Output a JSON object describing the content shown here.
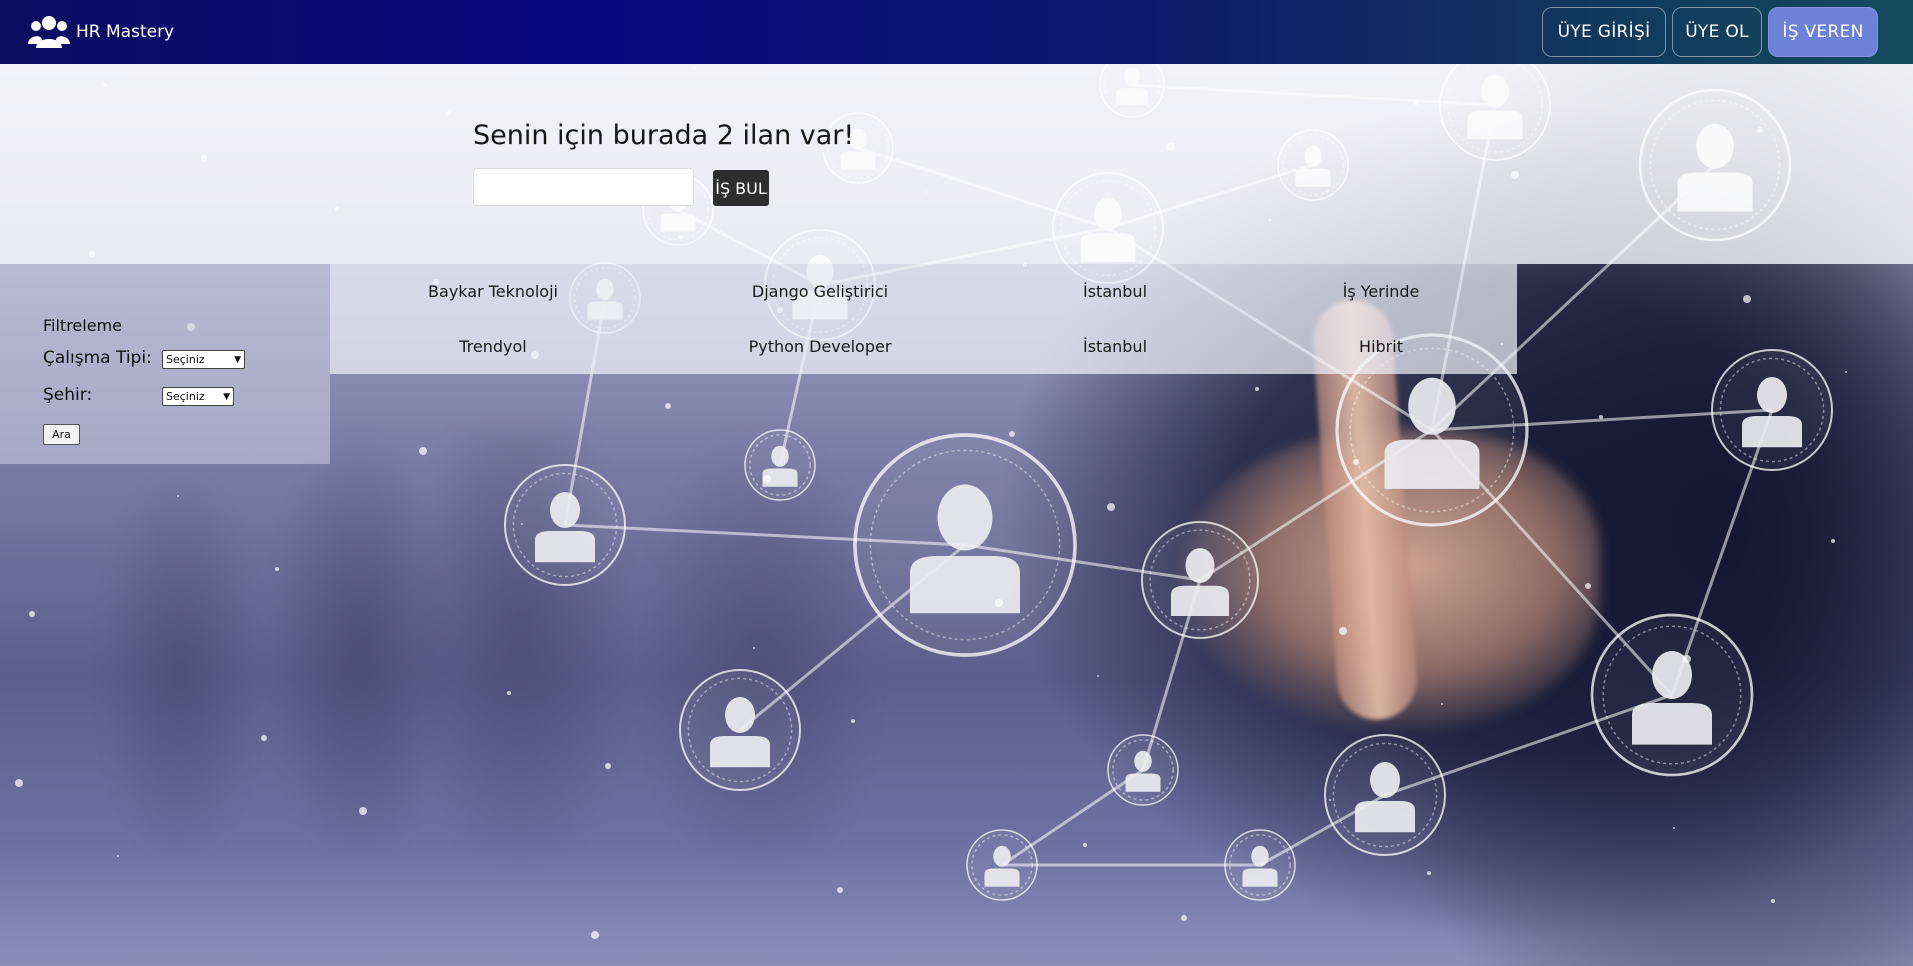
{
  "navbar": {
    "brand": "HR Mastery",
    "brand_icon": "users-icon",
    "buttons": {
      "login": "ÜYE GİRİŞİ",
      "register": "ÜYE OL",
      "employer": "İŞ VEREN"
    },
    "colors": {
      "bar_start": "#07077f",
      "bar_end": "#144a5d",
      "employer_button": "#6c82d8"
    }
  },
  "hero": {
    "title": "Senin için burada 2 ilan var!",
    "search_value": "",
    "search_button": "İŞ BUL"
  },
  "filters": {
    "title": "Filtreleme",
    "work_type_label": "Çalışma Tipi:",
    "work_type_selected": "Seçiniz",
    "city_label": "Şehir:",
    "city_selected": "Seçiniz",
    "apply_button": "Ara"
  },
  "jobs": [
    {
      "company": "Baykar Teknoloji",
      "position": "Django Geliştirici",
      "city": "İstanbul",
      "work_type": "İş Yerinde"
    },
    {
      "company": "Trendyol",
      "position": "Python Developer",
      "city": "İstanbul",
      "work_type": "Hibrit"
    }
  ]
}
